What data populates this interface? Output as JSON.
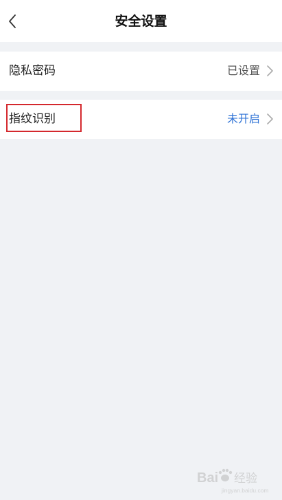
{
  "header": {
    "title": "安全设置",
    "back_icon": "chevron-left-icon"
  },
  "settings": [
    {
      "label": "隐私密码",
      "value": "已设置",
      "value_color": "#555555"
    },
    {
      "label": "指纹识别",
      "value": "未开启",
      "value_color": "#2f73d6"
    }
  ],
  "colors": {
    "background": "#f0f2f5",
    "highlight": "#d4282d"
  },
  "watermark": {
    "text_a": "Bai",
    "text_b": "经验",
    "url": "jingyan.baidu.com"
  }
}
